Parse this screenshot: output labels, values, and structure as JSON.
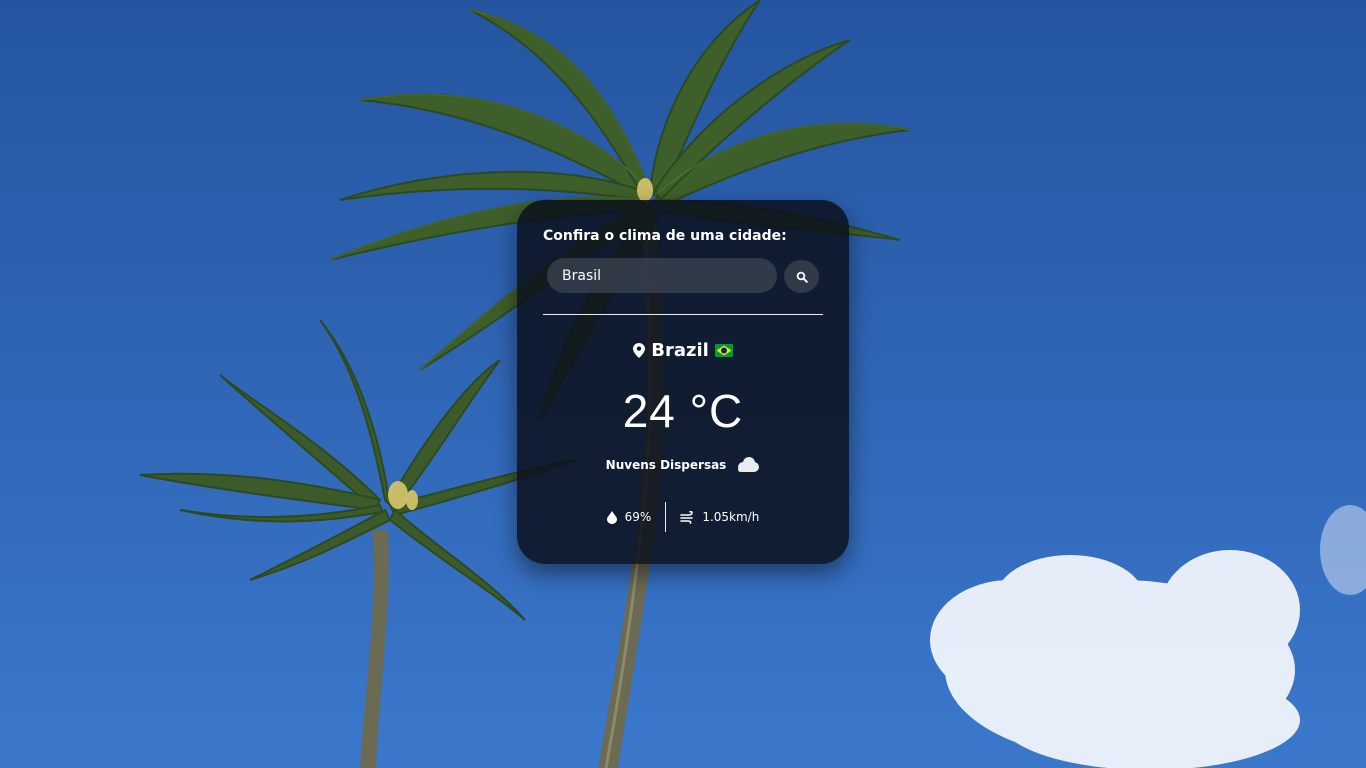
{
  "card": {
    "title": "Confira o clima de uma cidade:",
    "search": {
      "value": "Brasil",
      "placeholder": "",
      "button_icon": "search-icon"
    },
    "location": {
      "icon": "map-pin-icon",
      "name": "Brazil",
      "flag_icon": "brazil-flag-icon"
    },
    "temperature": "24 °C",
    "description": "Nuvens Dispersas",
    "description_icon": "cloud-icon",
    "humidity": {
      "icon": "water-drop-icon",
      "value": "69%"
    },
    "wind": {
      "icon": "wind-icon",
      "value": "1.05km/h"
    }
  },
  "colors": {
    "sky_top": "#2555a0",
    "sky_bottom": "#3b78cc",
    "card_background": "#0a101c",
    "text": "#ffffff",
    "flag_green": "#009c3b",
    "flag_yellow": "#ffdf00",
    "flag_blue": "#002776"
  }
}
